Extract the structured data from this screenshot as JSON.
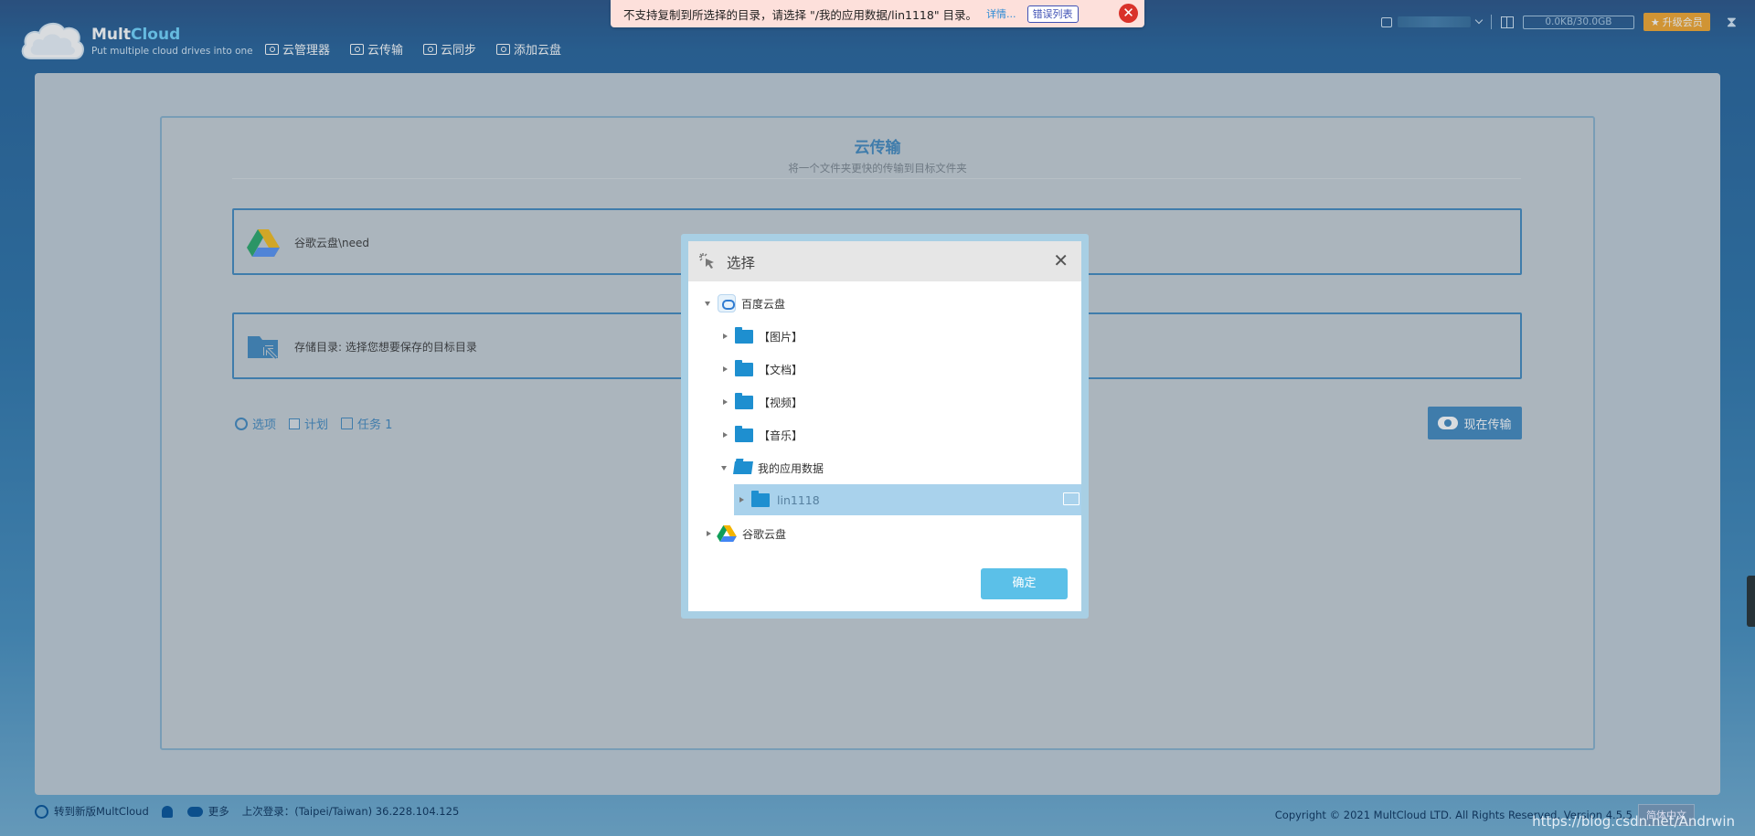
{
  "header": {
    "logo_name_a": "Mult",
    "logo_name_b": "Cloud",
    "logo_tagline": "Put multiple cloud drives into one",
    "nav": [
      {
        "label": "云管理器"
      },
      {
        "label": "云传输"
      },
      {
        "label": "云同步"
      },
      {
        "label": "添加云盘"
      }
    ],
    "quota": "0.0KB/30.0GB",
    "upgrade_label": "升级会员",
    "upgrade_star": "★"
  },
  "toast": {
    "message": "不支持复制到所选择的目录，请选择 \"/我的应用数据/lin1118\" 目录。",
    "details_link": "详情...",
    "error_list_button": "错误列表",
    "close_symbol": "✕"
  },
  "page": {
    "title": "云传输",
    "subtitle": "将一个文件夹更快的传输到目标文件夹",
    "source_label": "谷歌云盘\\need",
    "destination_label": "存储目录: 选择您想要保存的目标目录",
    "options_label": "选项",
    "schedule_label": "计划",
    "task_label": "任务 1",
    "transfer_now_label": "现在传输"
  },
  "modal": {
    "title": "选择",
    "close_symbol": "✕",
    "tree": [
      {
        "label": "百度云盘",
        "level": 0,
        "expanded": true,
        "icon": "baidu-cloud-icon"
      },
      {
        "label": "【图片】",
        "level": 1,
        "expanded": false,
        "icon": "folder-icon"
      },
      {
        "label": "【文档】",
        "level": 1,
        "expanded": false,
        "icon": "folder-icon"
      },
      {
        "label": "【视频】",
        "level": 1,
        "expanded": false,
        "icon": "folder-icon"
      },
      {
        "label": "【音乐】",
        "level": 1,
        "expanded": false,
        "icon": "folder-icon"
      },
      {
        "label": "我的应用数据",
        "level": 1,
        "expanded": true,
        "icon": "folder-open-icon"
      },
      {
        "label": "lin1118",
        "level": 2,
        "expanded": false,
        "selected": true,
        "icon": "folder-icon"
      },
      {
        "label": "谷歌云盘",
        "level": 0,
        "expanded": false,
        "icon": "google-drive-icon"
      }
    ],
    "confirm_label": "确定"
  },
  "footer": {
    "new_version_label": "转到新版MultCloud",
    "more_label": "更多",
    "last_login": "上次登录：(Taipei/Taiwan) 36.228.104.125",
    "copyright": "Copyright © 2021 MultCloud LTD. All Rights Reserved. Version 4.5.5",
    "language_button": "简体中文",
    "watermark": "https://blog.csdn.net/Andrwin"
  },
  "colors": {
    "accent": "#2a7ab8",
    "upgrade": "#f39c12",
    "toast_bg": "#fde0db",
    "toast_close": "#d9322a",
    "selected_row": "#a9d2ec",
    "confirm": "#5bc0e8"
  }
}
